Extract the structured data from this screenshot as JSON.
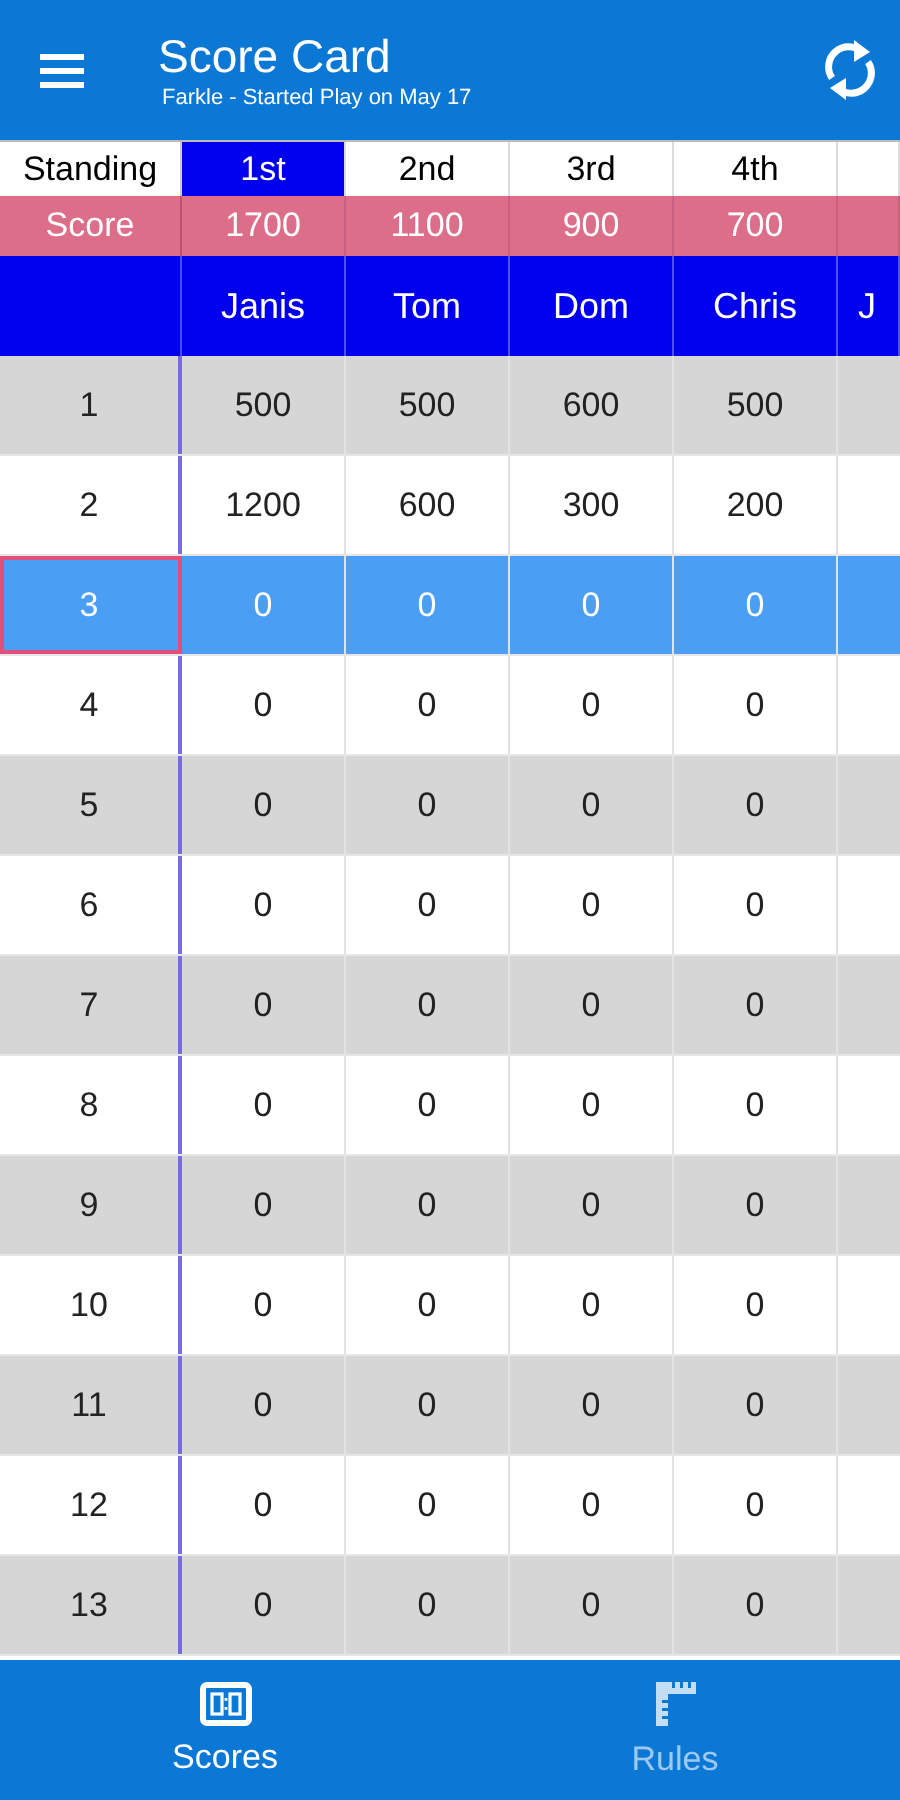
{
  "app_bar": {
    "title": "Score Card",
    "subtitle": "Farkle - Started Play on May 17"
  },
  "standing_label": "Standing",
  "score_label": "Score",
  "players": [
    {
      "standing": "1st",
      "score": "1700",
      "name": "Janis",
      "leader": true
    },
    {
      "standing": "2nd",
      "score": "1100",
      "name": "Tom",
      "leader": false
    },
    {
      "standing": "3rd",
      "score": "900",
      "name": "Dom",
      "leader": false
    },
    {
      "standing": "4th",
      "score": "700",
      "name": "Chris",
      "leader": false
    },
    {
      "name": "J",
      "leader": false
    }
  ],
  "rounds": [
    {
      "round": "1",
      "selected": false,
      "scores": [
        "500",
        "500",
        "600",
        "500"
      ]
    },
    {
      "round": "2",
      "selected": false,
      "scores": [
        "1200",
        "600",
        "300",
        "200"
      ]
    },
    {
      "round": "3",
      "selected": true,
      "scores": [
        "0",
        "0",
        "0",
        "0"
      ]
    },
    {
      "round": "4",
      "selected": false,
      "scores": [
        "0",
        "0",
        "0",
        "0"
      ]
    },
    {
      "round": "5",
      "selected": false,
      "scores": [
        "0",
        "0",
        "0",
        "0"
      ]
    },
    {
      "round": "6",
      "selected": false,
      "scores": [
        "0",
        "0",
        "0",
        "0"
      ]
    },
    {
      "round": "7",
      "selected": false,
      "scores": [
        "0",
        "0",
        "0",
        "0"
      ]
    },
    {
      "round": "8",
      "selected": false,
      "scores": [
        "0",
        "0",
        "0",
        "0"
      ]
    },
    {
      "round": "9",
      "selected": false,
      "scores": [
        "0",
        "0",
        "0",
        "0"
      ]
    },
    {
      "round": "10",
      "selected": false,
      "scores": [
        "0",
        "0",
        "0",
        "0"
      ]
    },
    {
      "round": "11",
      "selected": false,
      "scores": [
        "0",
        "0",
        "0",
        "0"
      ]
    },
    {
      "round": "12",
      "selected": false,
      "scores": [
        "0",
        "0",
        "0",
        "0"
      ]
    },
    {
      "round": "13",
      "selected": false,
      "scores": [
        "0",
        "0",
        "0",
        "0"
      ]
    }
  ],
  "bottom_nav": [
    {
      "kind": "scores",
      "label": "Scores",
      "selected": true
    },
    {
      "kind": "rules",
      "label": "Rules",
      "selected": false
    }
  ]
}
